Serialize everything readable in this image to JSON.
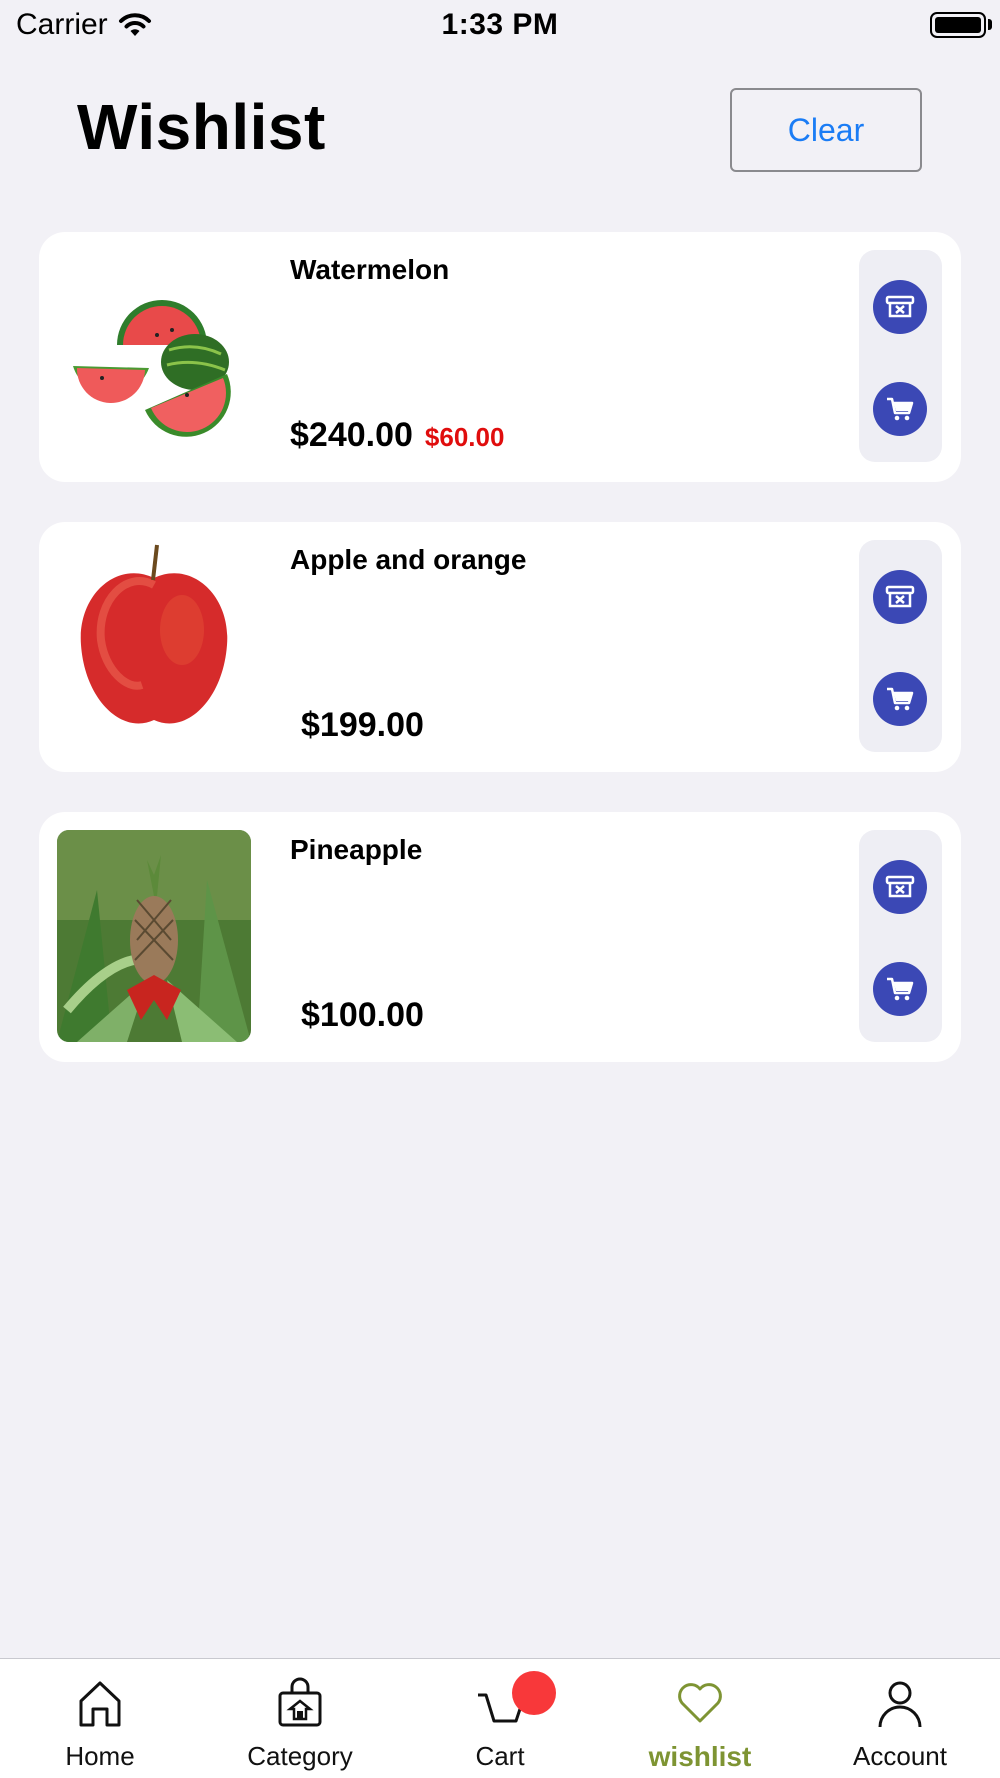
{
  "status_bar": {
    "carrier": "Carrier",
    "time": "1:33 PM"
  },
  "header": {
    "title": "Wishlist",
    "clear_label": "Clear"
  },
  "items": [
    {
      "name": "Watermelon",
      "price": "$240.00",
      "old_price": "$60.00",
      "image": "watermelon-image"
    },
    {
      "name": "Apple and orange",
      "price": "$199.00",
      "old_price": "",
      "image": "apple-image"
    },
    {
      "name": "Pineapple",
      "price": "$100.00",
      "old_price": "",
      "image": "pineapple-image"
    }
  ],
  "tabs": [
    {
      "label": "Home",
      "icon": "home-icon"
    },
    {
      "label": "Category",
      "icon": "category-icon"
    },
    {
      "label": "Cart",
      "icon": "cart-icon"
    },
    {
      "label": "wishlist",
      "icon": "heart-icon",
      "active": true
    },
    {
      "label": "Account",
      "icon": "account-icon"
    }
  ],
  "colors": {
    "accent": "#1a7cf5",
    "action": "#3b48b5",
    "active_tab": "#7e9433",
    "sale": "#e00d0d",
    "badge": "#f8383a"
  }
}
